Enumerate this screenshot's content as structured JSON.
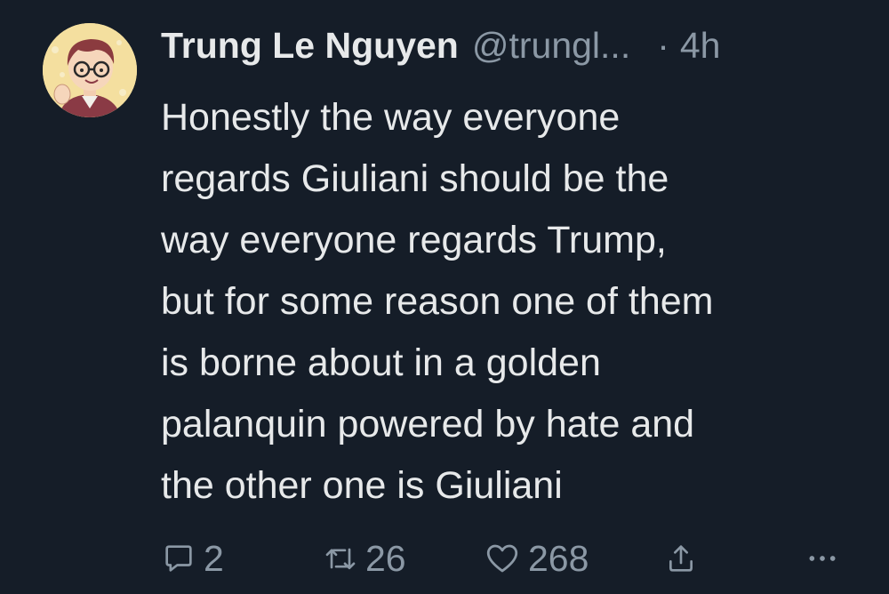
{
  "tweet": {
    "author": {
      "display_name": "Trung Le Nguyen",
      "handle": "@trungl...",
      "avatar_icon": "cartoon-avatar-icon"
    },
    "separator": "·",
    "timestamp": "4h",
    "text_lines": [
      "Honestly the way everyone",
      "regards Giuliani should be the",
      "way everyone regards Trump,",
      "but for some reason one of them",
      "is borne about in a golden",
      "palanquin powered by hate and",
      "the other one is Giuliani"
    ],
    "actions": {
      "reply_count": "2",
      "retweet_count": "26",
      "like_count": "268"
    }
  },
  "colors": {
    "background": "#151d28",
    "text": "#e7e9ea",
    "muted": "#8b98a5"
  }
}
